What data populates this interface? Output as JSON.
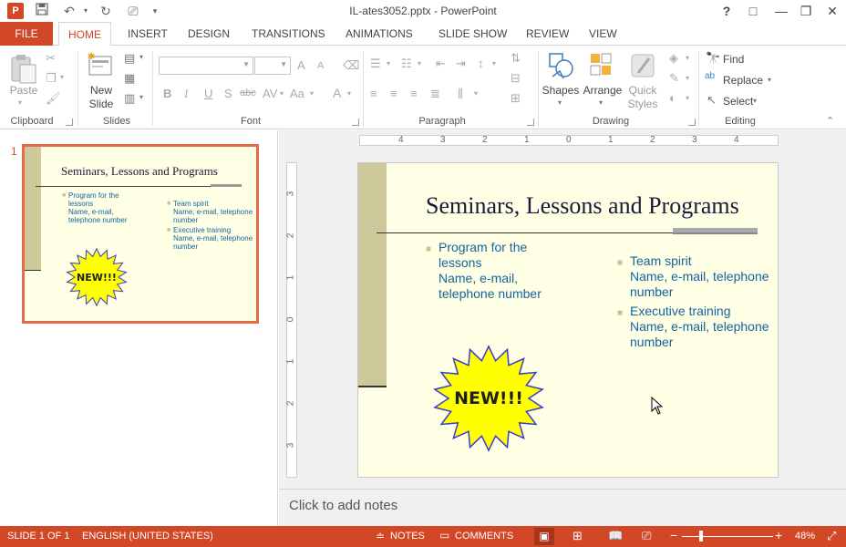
{
  "app": {
    "title": "IL-ates3052.pptx - PowerPoint",
    "window_buttons": [
      "?",
      "□",
      "—",
      "❐",
      "✕"
    ]
  },
  "tabs": [
    {
      "label": "FILE"
    },
    {
      "label": "HOME"
    },
    {
      "label": "INSERT"
    },
    {
      "label": "DESIGN"
    },
    {
      "label": "TRANSITIONS"
    },
    {
      "label": "ANIMATIONS"
    },
    {
      "label": "SLIDE SHOW"
    },
    {
      "label": "REVIEW"
    },
    {
      "label": "VIEW"
    }
  ],
  "ribbon": {
    "clipboard": {
      "label": "Clipboard",
      "paste": "Paste"
    },
    "slides": {
      "label": "Slides",
      "new_slide": "New Slide"
    },
    "font": {
      "label": "Font",
      "bold": "B",
      "italic": "I",
      "underline": "U",
      "shadow": "S",
      "strike": "abc",
      "spacing": "AV",
      "case": "Aa",
      "color": "A",
      "grow": "A",
      "shrink": "A"
    },
    "paragraph": {
      "label": "Paragraph"
    },
    "drawing": {
      "label": "Drawing",
      "shapes": "Shapes",
      "arrange": "Arrange",
      "quick_styles": "Quick Styles"
    },
    "editing": {
      "label": "Editing",
      "find": "Find",
      "replace": "Replace",
      "select": "Select"
    }
  },
  "thumbnail": {
    "number": "1",
    "title": "Seminars, Lessons and Programs",
    "left_bullet_1": "Program for the lessons",
    "left_bullet_1_sub": "Name, e-mail, telephone number",
    "right_bullet_1": "Team spirit",
    "right_bullet_1_sub": "Name, e-mail, telephone number",
    "right_bullet_2": "Executive training",
    "right_bullet_2_sub": "Name, e-mail, telephone number",
    "burst": "NEW!!!"
  },
  "slide": {
    "title": "Seminars, Lessons and Programs",
    "left_bullet_1_a": "Program for the",
    "left_bullet_1_b": "lessons",
    "left_bullet_1_c": "Name, e-mail,",
    "left_bullet_1_d": "telephone number",
    "right_bullet_1_a": "Team spirit",
    "right_bullet_1_b": "Name, e-mail, telephone",
    "right_bullet_1_c": "number",
    "right_bullet_2_a": "Executive training",
    "right_bullet_2_b": "Name, e-mail, telephone",
    "right_bullet_2_c": "number",
    "burst": "NEW!!!"
  },
  "ruler": {
    "h_ticks": [
      "4",
      "3",
      "2",
      "1",
      "0",
      "1",
      "2",
      "3",
      "4"
    ],
    "v_ticks": [
      "3",
      "2",
      "1",
      "0",
      "1",
      "2",
      "3"
    ]
  },
  "notes": {
    "placeholder": "Click to add notes"
  },
  "status": {
    "slide": "SLIDE 1 OF 1",
    "language": "ENGLISH (UNITED STATES)",
    "notes": "NOTES",
    "comments": "COMMENTS",
    "zoom": "48%"
  },
  "colors": {
    "accent": "#d24726",
    "slide_bg": "#ffffe5",
    "bullet_text": "#1464a0",
    "bar": "#cdc99a",
    "burst_fill": "#ffff00",
    "burst_stroke": "#3a3ad0"
  }
}
